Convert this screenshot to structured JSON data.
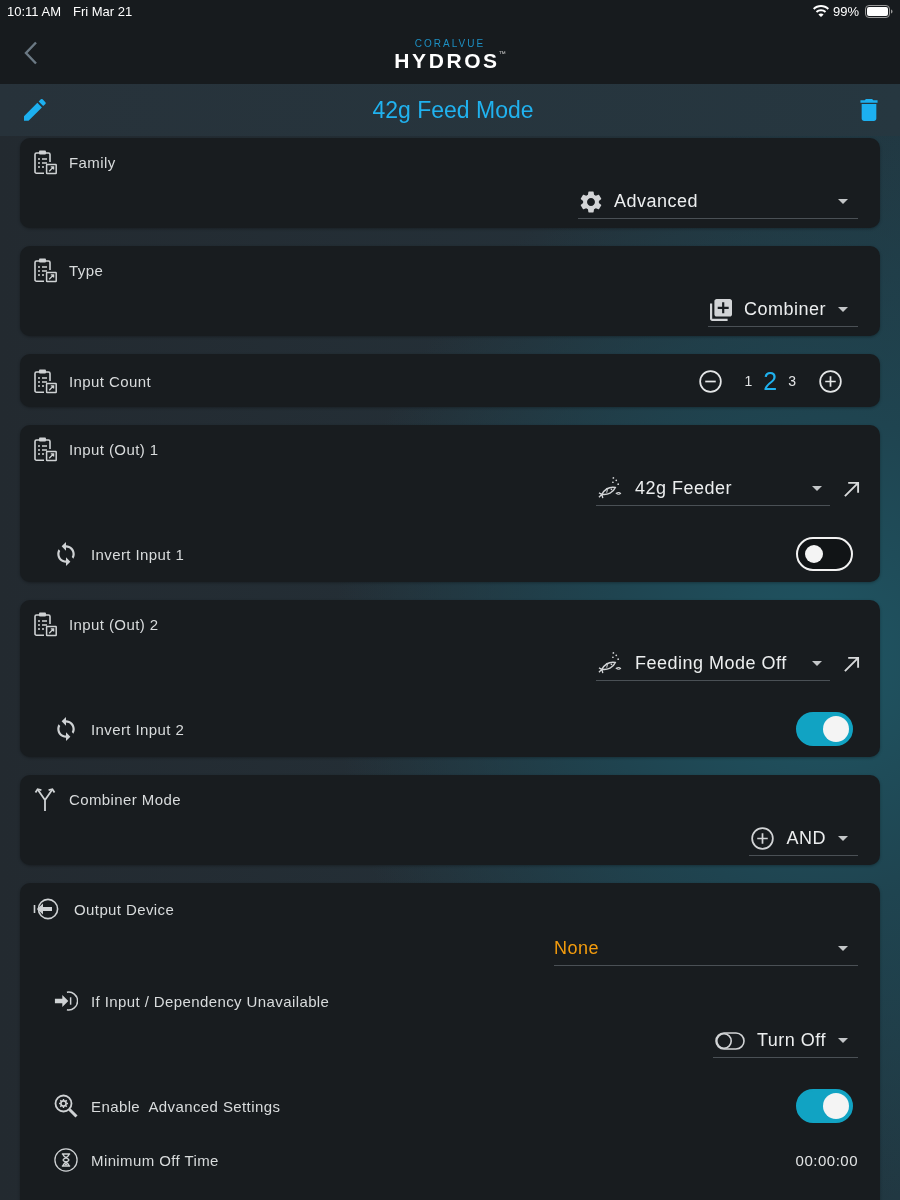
{
  "status_bar": {
    "time": "10:11 AM",
    "date": "Fri Mar 21",
    "battery": "99%"
  },
  "nav_bar": {
    "logo_top": "CORALVUE",
    "logo": "HYDROS",
    "trademark": "™"
  },
  "header": {
    "title": "42g Feed Mode"
  },
  "family": {
    "label": "Family",
    "value": "Advanced"
  },
  "type": {
    "label": "Type",
    "value": "Combiner"
  },
  "input_count": {
    "label": "Input Count",
    "options": [
      {
        "label": "1",
        "selected": false
      },
      {
        "label": "2",
        "selected": true
      },
      {
        "label": "3",
        "selected": false
      }
    ]
  },
  "inputs": [
    {
      "label": "Input (Out) 1",
      "value": "42g Feeder",
      "invert": {
        "label": "Invert Input 1",
        "on": false
      }
    },
    {
      "label": "Input (Out) 2",
      "value": "Feeding Mode Off",
      "invert": {
        "label": "Invert Input 2",
        "on": true
      }
    }
  ],
  "combiner_mode": {
    "label": "Combiner Mode",
    "value": "AND"
  },
  "output_device": {
    "label": "Output Device",
    "placeholder": "None",
    "if_unavailable": {
      "label": "If Input / Dependency Unavailable",
      "value": "Turn Off"
    },
    "advanced_settings": {
      "label": "Enable  Advanced Settings",
      "on": true
    },
    "minimum_off_time": {
      "label": "Minimum Off Time",
      "value": "00:00:00"
    }
  }
}
